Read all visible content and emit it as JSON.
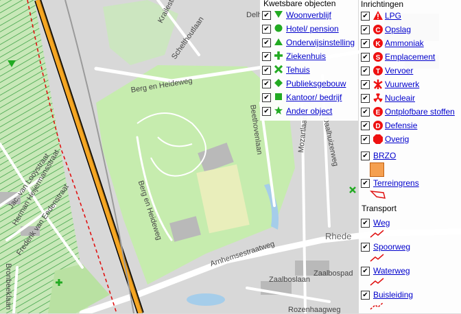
{
  "map": {
    "street_labels": [
      "Krailesteijn",
      "Schelthoutlaan",
      "Berg en Heideweg",
      "Beethovenlaan",
      "Mozartlaan",
      "Daalhuizerweg",
      "Berg en Heideweg",
      "Arnhemsestraatweg",
      "Zaalboslaan",
      "Zaalbospad",
      "Rozenhaagweg",
      "Jac. van Looystraat",
      "Herman Heijermansstraat",
      "Frederik van Eedenstraat",
      "Bronbeeklaan",
      "Rhede",
      "Delh"
    ]
  },
  "kwetsbare": {
    "title": "Kwetsbare objecten",
    "items": [
      {
        "label": "Woonverblijf",
        "icon": "triangle-down-icon",
        "checked": "✔"
      },
      {
        "label": "Hotel/ pension",
        "icon": "circle-icon",
        "checked": "✔"
      },
      {
        "label": "Onderwijsinstelling",
        "icon": "triangle-up-icon",
        "checked": "✔"
      },
      {
        "label": "Ziekenhuis",
        "icon": "plus-icon",
        "checked": "✔"
      },
      {
        "label": "Tehuis",
        "icon": "x-icon",
        "checked": "✔"
      },
      {
        "label": "Publieksgebouw",
        "icon": "diamond-icon",
        "checked": "✔"
      },
      {
        "label": "Kantoor/ bedrijf",
        "icon": "square-icon",
        "checked": "✔"
      },
      {
        "label": "Ander object",
        "icon": "star-icon",
        "checked": "✔"
      }
    ],
    "color": "#22aa22"
  },
  "inrichtingen": {
    "title": "Inrichtingen",
    "items": [
      {
        "label": "LPG",
        "icon": "warning-triangle-icon",
        "checked": "✔"
      },
      {
        "label": "Opslag",
        "icon": "letter-c-icon",
        "letter": "C",
        "checked": "✔"
      },
      {
        "label": "Ammoniak",
        "icon": "letter-k-icon",
        "letter": "K",
        "checked": "✔"
      },
      {
        "label": "Emplacement",
        "icon": "letter-s-icon",
        "letter": "S",
        "checked": "✔"
      },
      {
        "label": "Vervoer",
        "icon": "letter-t-icon",
        "letter": "T",
        "checked": "✔"
      },
      {
        "label": "Vuurwerk",
        "icon": "firework-icon",
        "checked": "✔"
      },
      {
        "label": "Nucleair",
        "icon": "radiation-icon",
        "checked": "✔"
      },
      {
        "label": "Ontplofbare stoffen",
        "icon": "letter-e-icon",
        "letter": "E",
        "checked": "✔"
      },
      {
        "label": "Defensie",
        "icon": "letter-d-icon",
        "letter": "D",
        "checked": "✔"
      },
      {
        "label": "Overig",
        "icon": "octagon-icon",
        "checked": "✔"
      }
    ],
    "color": "#ee1111"
  },
  "areas": [
    {
      "label": "BRZO",
      "checked": "✔",
      "swatch_color": "#f5a050"
    },
    {
      "label": "Terreingrens",
      "checked": "✔",
      "swatch_color": "#e01010"
    }
  ],
  "transport": {
    "title": "Transport",
    "items": [
      {
        "label": "Weg",
        "checked": "✔"
      },
      {
        "label": "Spoorweg",
        "checked": "✔"
      },
      {
        "label": "Waterweg",
        "checked": "✔"
      },
      {
        "label": "Buisleiding",
        "checked": "✔"
      }
    ],
    "line_color": "#e01010"
  }
}
